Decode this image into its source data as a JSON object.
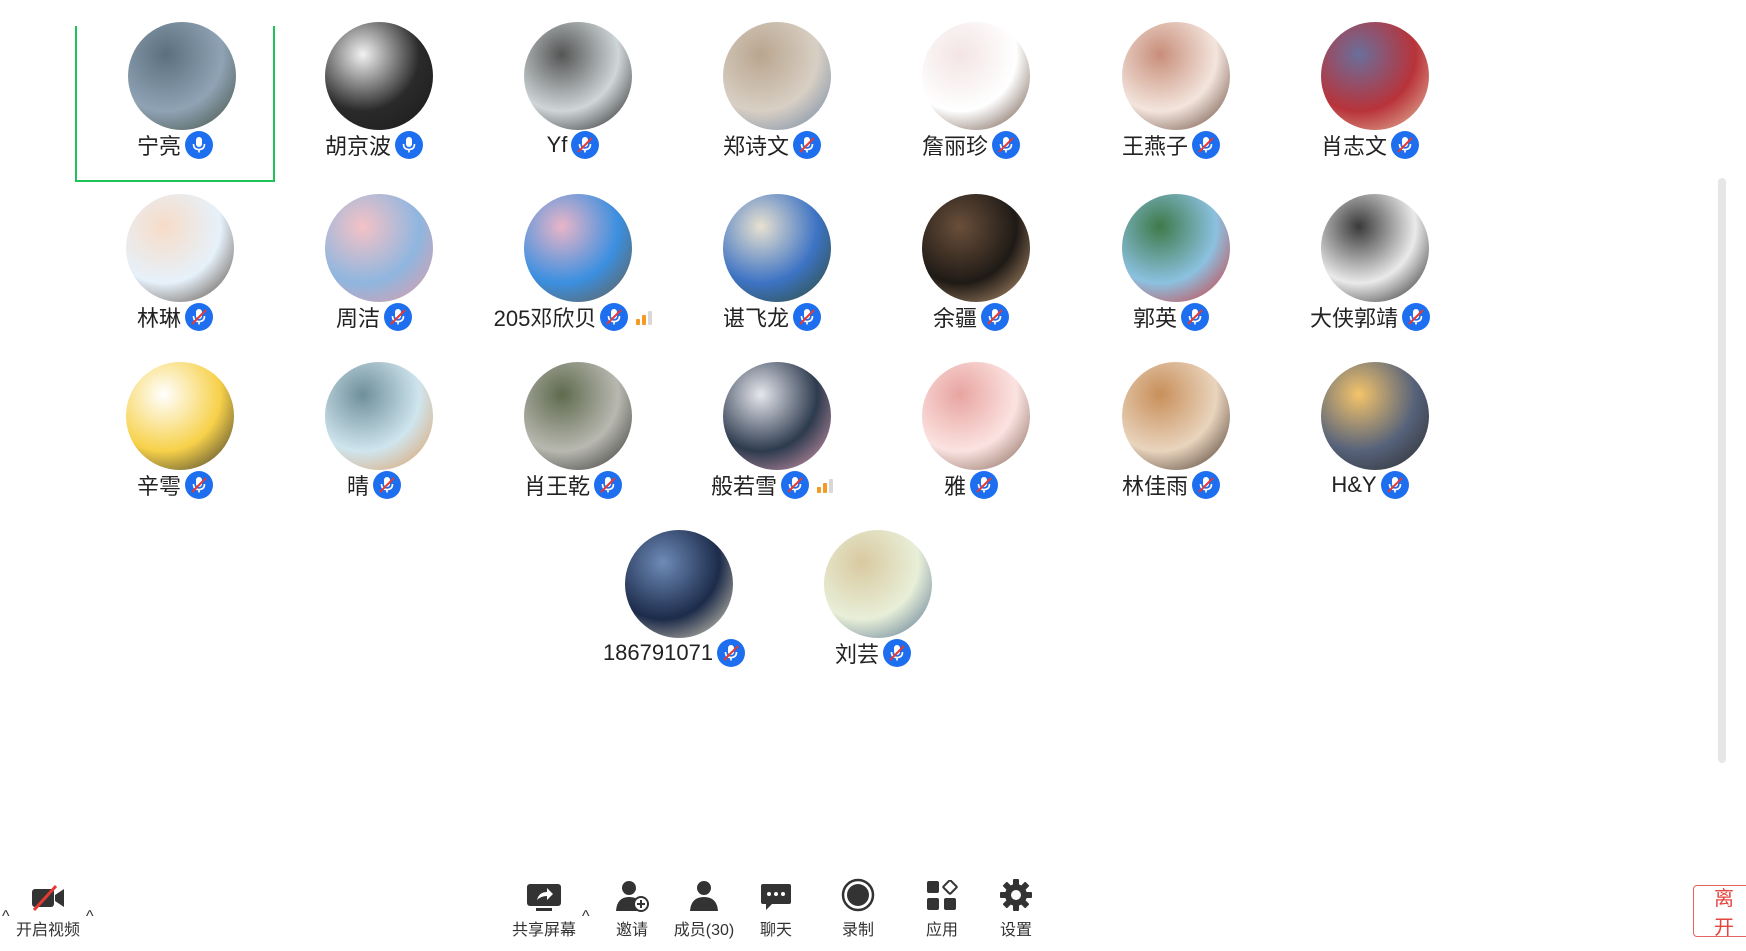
{
  "participants": [
    {
      "name": "宁亮",
      "mic": "on",
      "active": true,
      "signal": 0,
      "colors": [
        "#8fa3b5",
        "#5c6f7e",
        "#3e4a3a"
      ]
    },
    {
      "name": "胡京波",
      "mic": "on",
      "active": false,
      "signal": 0,
      "colors": [
        "#2a2a2a",
        "#f2f2f2",
        "#1a1a1a"
      ]
    },
    {
      "name": "Yf",
      "mic": "muted",
      "active": false,
      "signal": 0,
      "colors": [
        "#cfd6d8",
        "#555",
        "#111"
      ]
    },
    {
      "name": "郑诗文",
      "mic": "muted",
      "active": false,
      "signal": 0,
      "colors": [
        "#d8cfc4",
        "#b9a58e",
        "#6a82a2"
      ]
    },
    {
      "name": "詹丽珍",
      "mic": "muted",
      "active": false,
      "signal": 0,
      "colors": [
        "#ffffff",
        "#f3e4e4",
        "#5a4030"
      ]
    },
    {
      "name": "王燕子",
      "mic": "muted",
      "active": false,
      "signal": 0,
      "colors": [
        "#f3e5dd",
        "#c88e7a",
        "#5a3a2a"
      ]
    },
    {
      "name": "肖志文",
      "mic": "muted",
      "active": false,
      "signal": 0,
      "colors": [
        "#b8333a",
        "#6a6f9c",
        "#e9c7a8"
      ]
    },
    {
      "name": "林琳",
      "mic": "muted",
      "active": false,
      "signal": 0,
      "colors": [
        "#e6f1fa",
        "#f7dcc8",
        "#4a3a30"
      ]
    },
    {
      "name": "周洁",
      "mic": "muted",
      "active": false,
      "signal": 0,
      "colors": [
        "#8fb6df",
        "#f4c2c6",
        "#e79aa4"
      ]
    },
    {
      "name": "205邓欣贝",
      "mic": "muted",
      "active": false,
      "signal": 2,
      "colors": [
        "#3b8fe0",
        "#e9b5c8",
        "#6b5a40"
      ]
    },
    {
      "name": "谌飞龙",
      "mic": "muted",
      "active": false,
      "signal": 0,
      "colors": [
        "#3d73c4",
        "#e8e1d0",
        "#2d4a2a"
      ]
    },
    {
      "name": "余疆",
      "mic": "muted",
      "active": false,
      "signal": 0,
      "colors": [
        "#1f1a16",
        "#6a4f3a",
        "#c9a27a"
      ]
    },
    {
      "name": "郭英",
      "mic": "muted",
      "active": false,
      "signal": 0,
      "colors": [
        "#8cc1e0",
        "#3e7a4a",
        "#d62e2e"
      ]
    },
    {
      "name": "大侠郭靖",
      "mic": "muted",
      "active": false,
      "signal": 0,
      "colors": [
        "#eaeaea",
        "#3a3a3a",
        "#111"
      ]
    },
    {
      "name": "辛雩",
      "mic": "muted",
      "active": false,
      "signal": 0,
      "colors": [
        "#f7d14a",
        "#ffffff",
        "#2a2a2a"
      ]
    },
    {
      "name": "晴",
      "mic": "muted",
      "active": false,
      "signal": 0,
      "colors": [
        "#cfe5ee",
        "#6f8f9a",
        "#e09a5a"
      ]
    },
    {
      "name": "肖王乾",
      "mic": "muted",
      "active": false,
      "signal": 0,
      "colors": [
        "#b8b8b0",
        "#5f6a4e",
        "#2a2a2a"
      ]
    },
    {
      "name": "般若雪",
      "mic": "muted",
      "active": false,
      "signal": 2,
      "colors": [
        "#2d3b4e",
        "#e7e7ee",
        "#e9a3b8"
      ]
    },
    {
      "name": "雅",
      "mic": "muted",
      "active": false,
      "signal": 0,
      "colors": [
        "#fbe3e1",
        "#e8a4a0",
        "#7a5a4a"
      ]
    },
    {
      "name": "林佳雨",
      "mic": "muted",
      "active": false,
      "signal": 0,
      "colors": [
        "#e9d4bd",
        "#c88f5a",
        "#3a2a20"
      ]
    },
    {
      "name": "H&Y",
      "mic": "muted",
      "active": false,
      "signal": 0,
      "colors": [
        "#56627a",
        "#f4c46a",
        "#2a2a2a"
      ]
    },
    {
      "name": "186791071",
      "mic": "muted",
      "active": false,
      "signal": 0,
      "colors": [
        "#1c2b4a",
        "#6e8bb8",
        "#f3e7c8"
      ]
    },
    {
      "name": "刘芸",
      "mic": "muted",
      "active": false,
      "signal": 0,
      "colors": [
        "#e8efd8",
        "#d9c9a0",
        "#4a6a8a"
      ]
    }
  ],
  "toolbar": {
    "video": {
      "label": "开启视频",
      "icon": "camera-off-icon"
    },
    "share": {
      "label": "共享屏幕",
      "icon": "share-screen-icon"
    },
    "invite": {
      "label": "邀请",
      "icon": "invite-user-icon"
    },
    "members": {
      "label": "成员(30)",
      "icon": "members-icon"
    },
    "chat": {
      "label": "聊天",
      "icon": "chat-icon"
    },
    "record": {
      "label": "录制",
      "icon": "record-icon"
    },
    "apps": {
      "label": "应用",
      "icon": "apps-icon"
    },
    "settings": {
      "label": "设置",
      "icon": "gear-icon"
    },
    "leave": {
      "label": "离开"
    }
  },
  "colors": {
    "mic": "#1e6ff0",
    "active_border": "#1fc159",
    "signal": "#f59a23",
    "leave": "#e5453f"
  }
}
